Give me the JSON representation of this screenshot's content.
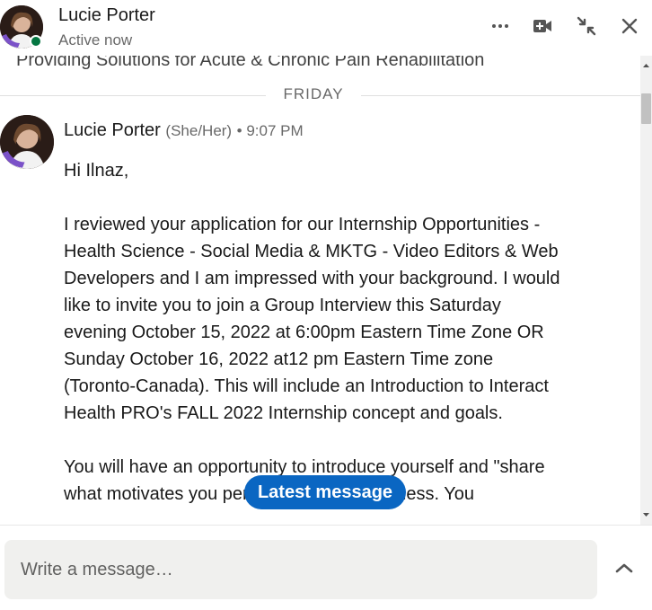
{
  "header": {
    "name": "Lucie Porter",
    "status": "Active now",
    "presence_color": "#057642",
    "icons": [
      "more-options-icon",
      "video-call-icon",
      "minimize-icon",
      "close-icon"
    ]
  },
  "conversation": {
    "cut_off_headline": "Providing Solutions for Acute & Chronic Pain Rehabilitation",
    "date_divider": "FRIDAY",
    "message": {
      "sender": "Lucie Porter",
      "pronouns": "(She/Her)",
      "time": "• 9:07 PM",
      "paragraphs": [
        "Hi Ilnaz,",
        "I reviewed your application for our Internship Opportunities - Health Science - Social Media & MKTG - Video Editors & Web Developers and I am impressed with your background. I would like to invite you to join a Group Interview this Saturday evening October 15, 2022 at 6:00pm Eastern Time Zone OR Sunday October 16, 2022 at12 pm Eastern Time zone (Toronto-Canada). This will include an Introduction to Interact Health PRO's FALL 2022 Internship concept and goals.",
        "You will have an opportunity to introduce yourself and \"share what motivates you personally and in business. You"
      ]
    }
  },
  "latest_message_button": "Latest message",
  "composer": {
    "placeholder": "Write a message…",
    "value": ""
  },
  "colors": {
    "accent": "#0a66c2",
    "composer_bg": "#f0f0ee"
  }
}
